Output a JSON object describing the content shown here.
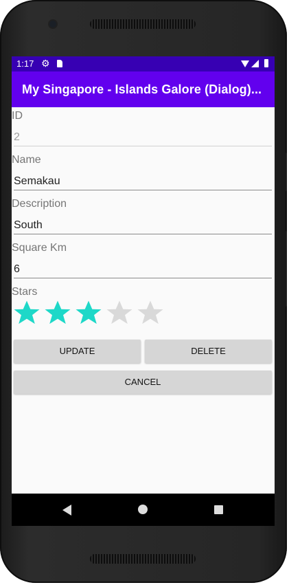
{
  "status_bar": {
    "time": "1:17"
  },
  "app_bar": {
    "title": "My Singapore - Islands Galore (Dialog)..."
  },
  "form": {
    "id_label": "ID",
    "id_value": "2",
    "name_label": "Name",
    "name_value": "Semakau",
    "description_label": "Description",
    "description_value": "South",
    "square_km_label": "Square Km",
    "square_km_value": "6",
    "stars_label": "Stars",
    "stars_rating": 3,
    "stars_max": 5
  },
  "buttons": {
    "update": "UPDATE",
    "delete": "DELETE",
    "cancel": "CANCEL"
  },
  "colors": {
    "status_bar": "#3700b3",
    "app_bar": "#6200ee",
    "star_filled": "#1ed8c8",
    "star_empty": "#d9d9d9"
  },
  "icons": {
    "status": [
      "settings-gear-icon",
      "sim-card-icon",
      "wifi-icon",
      "signal-icon",
      "battery-icon"
    ],
    "nav": [
      "back-icon",
      "home-icon",
      "recents-icon"
    ]
  }
}
